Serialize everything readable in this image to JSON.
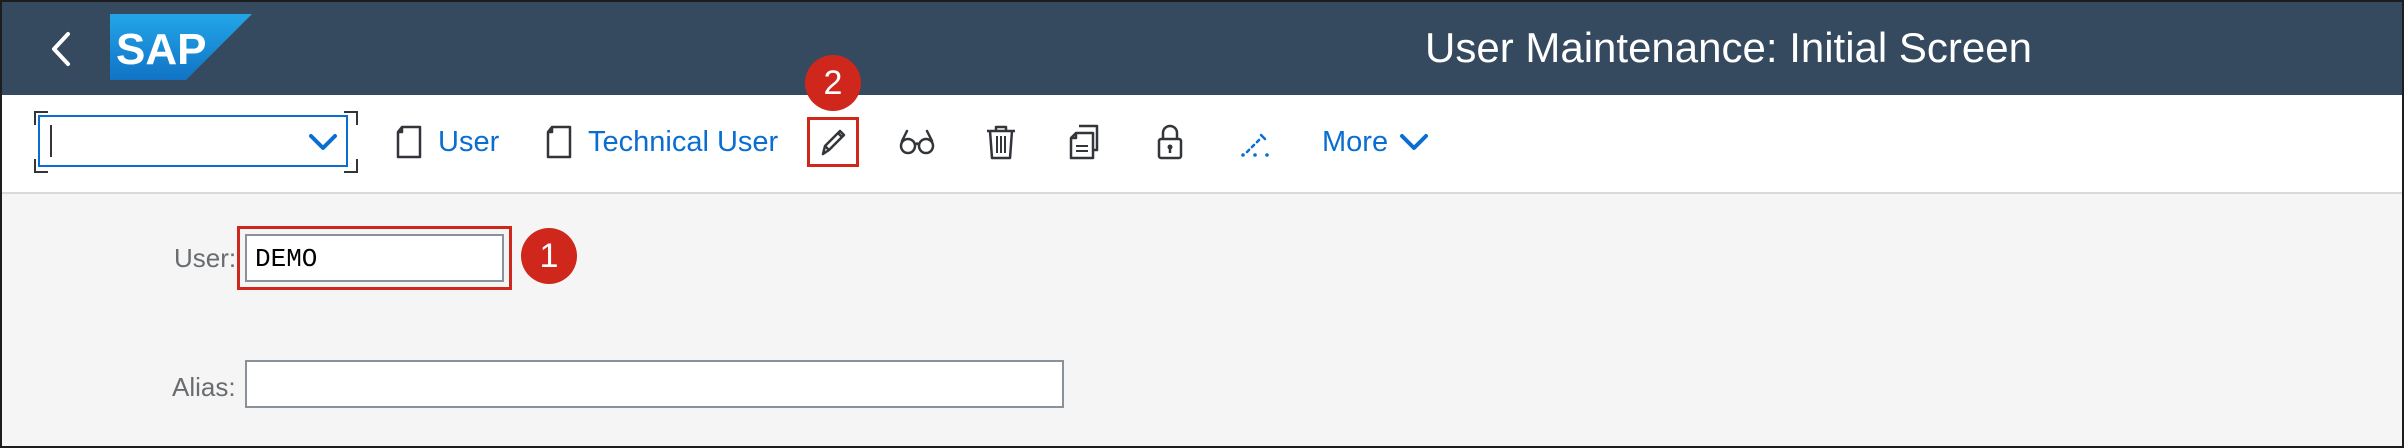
{
  "shell": {
    "title": "User Maintenance: Initial Screen",
    "logo_text": "SAP",
    "back_icon": "chevron-left-icon"
  },
  "toolbar": {
    "command_field": {
      "value": ""
    },
    "buttons": [
      {
        "label": "User",
        "icon": "document-icon"
      },
      {
        "label": "Technical User",
        "icon": "document-icon"
      },
      {
        "label": "",
        "icon": "edit-pencil-icon"
      },
      {
        "label": "",
        "icon": "display-glasses-icon"
      },
      {
        "label": "",
        "icon": "delete-trash-icon"
      },
      {
        "label": "",
        "icon": "copy-icon"
      },
      {
        "label": "",
        "icon": "lock-icon"
      },
      {
        "label": "",
        "icon": "change-password-icon"
      },
      {
        "label": "More",
        "icon": "chevron-down-icon"
      }
    ]
  },
  "form": {
    "user": {
      "label": "User:",
      "value": "DEMO"
    },
    "alias": {
      "label": "Alias:",
      "value": ""
    }
  },
  "annotations": {
    "step1": "1",
    "step2": "2"
  },
  "colors": {
    "shell_bg": "#354a5f",
    "accent": "#0a6ed1",
    "highlight": "#d0271d",
    "content_bg": "#f5f5f5"
  }
}
